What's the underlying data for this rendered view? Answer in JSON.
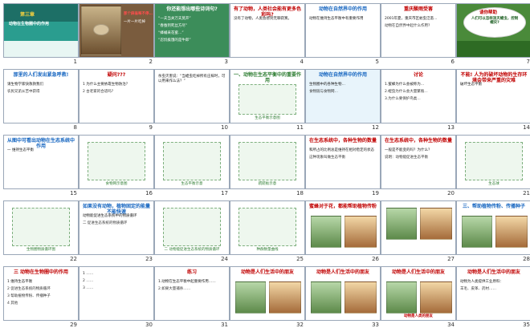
{
  "colors": {
    "frame": "#9aa7b8",
    "title_red": "#c00000",
    "teal": "#2f8f8a",
    "green": "#2e7d32",
    "sky": "#bfe3f5",
    "forest": "#3b6b2e"
  },
  "slides": [
    {
      "n": "1",
      "bg": "#2a9d8f",
      "title": "第三章",
      "body": [
        "动物在生物圈中的作用"
      ],
      "accent": "#f4d03f",
      "kind": "cover"
    },
    {
      "n": "2",
      "bg": "#7a5c3e",
      "title": "",
      "body": [
        "那个麻雀啄不停…",
        "一片一片吃掉"
      ],
      "accent": "#e74c3c",
      "kind": "photo"
    },
    {
      "n": "3",
      "bg": "#3c8d5a",
      "title": "你还能想出哪些诗词句?",
      "body": [
        "“一夫当关万夫莫开”",
        "“春蚕到死丝方尽”",
        "“蜂蛹采花蜜…”",
        "“忍饥挨饿的是牛郎”"
      ],
      "accent": "#ffffff",
      "kind": "text"
    },
    {
      "n": "4",
      "bg": "#ffffff",
      "title": "有了动物，人类社会能有更多色彩吗?",
      "body": [
        "没有了动物，人类会感到无聊寂寞。"
      ],
      "accent": "#c00000",
      "kind": "text"
    },
    {
      "n": "5",
      "bg": "#ffffff",
      "title": "动物在自然界中的作用",
      "body": [
        "动物在维持生态平衡中有重要作用"
      ],
      "accent": "#1565c0",
      "kind": "text"
    },
    {
      "n": "6",
      "bg": "#ffffff",
      "title": "重庆酸雨受害",
      "body": [
        "2001年夏，重庆市区蚊虫泛滥…",
        "动物在自然界中起什么作用?"
      ],
      "accent": "#c00000",
      "kind": "text"
    },
    {
      "n": "7",
      "bg": "#4a8a3a",
      "title": "请你帮助",
      "body": [
        "人们可以怎样消灭蝗虫，控制蝗灾?"
      ],
      "accent": "#f1c40f",
      "kind": "bubble"
    },
    {
      "n": "8",
      "bg": "#ffffff",
      "title": "那里的人们发出紧急呼救!",
      "body": [
        "请生物学家快救救我们",
        "农民兄弟从苦中获得"
      ],
      "accent": "#1565c0",
      "kind": "text"
    },
    {
      "n": "9",
      "bg": "#ffffff",
      "title": "疑问???",
      "body": [
        "1 为什么主要依靠生物防治？",
        "2 古老家的合适吗?"
      ],
      "accent": "#c00000",
      "kind": "text"
    },
    {
      "n": "10",
      "bg": "#ffffff",
      "title": "",
      "body": [
        "杀虫灭害说：“当蝗虫吃掉所有庄稼时，可以用来作么法？”"
      ],
      "accent": "#1565c0",
      "kind": "text"
    },
    {
      "n": "11",
      "bg": "#ffffff",
      "title": "一、动物在生态平衡中的重要作用",
      "body": [
        "生态平衡示意图"
      ],
      "accent": "#2e7d32",
      "kind": "diagram"
    },
    {
      "n": "12",
      "bg": "#e8f4fb",
      "title": "动物在自然界中的作用",
      "body": [
        "生物圈中的各种生物…",
        "食物链与食物网…"
      ],
      "accent": "#1565c0",
      "kind": "text"
    },
    {
      "n": "13",
      "bg": "#ffffff",
      "title": "讨论",
      "body": [
        "1.蜜蜂为什么会被称为…",
        "2.蝗虫为什么会大量繁殖…",
        "3.为什么要保护鸟类…"
      ],
      "accent": "#c00000",
      "kind": "text"
    },
    {
      "n": "14",
      "bg": "#ffffff",
      "title": "不能! 人为的破坏动物的生存环境会带来严重的灾难",
      "body": [
        "破坏生态平衡"
      ],
      "accent": "#c00000",
      "kind": "text"
    },
    {
      "n": "15",
      "bg": "#ffffff",
      "title": "从图中可看出动物在生态系统中作用",
      "body": [
        "一 维持生态平衡"
      ],
      "accent": "#1565c0",
      "kind": "text"
    },
    {
      "n": "16",
      "bg": "#ffffff",
      "title": "",
      "body": [
        "食物网示意图"
      ],
      "accent": "#2e7d32",
      "kind": "diagram"
    },
    {
      "n": "17",
      "bg": "#ffffff",
      "title": "",
      "body": [
        "生态平衡示意"
      ],
      "accent": "#2e7d32",
      "kind": "diagram"
    },
    {
      "n": "18",
      "bg": "#ffffff",
      "title": "",
      "body": [
        "跷跷板示意"
      ],
      "accent": "#2e7d32",
      "kind": "diagram"
    },
    {
      "n": "19",
      "bg": "#ffffff",
      "title": "在生态系统中，各种生物的数量",
      "body": [
        "和所占的比例总是维持在相对稳定的状态",
        "这种现象叫做生态平衡"
      ],
      "accent": "#c00000",
      "kind": "text"
    },
    {
      "n": "20",
      "bg": "#ffffff",
      "title": "在生态系统中，各种生物的数量",
      "body": [
        "一般是不能变的吗？为什么？",
        "说明：动物能促进生态平衡"
      ],
      "accent": "#c00000",
      "kind": "text"
    },
    {
      "n": "21",
      "bg": "#ffffff",
      "title": "",
      "body": [
        "生态球"
      ],
      "accent": "#2e7d32",
      "kind": "diagram"
    },
    {
      "n": "22",
      "bg": "#ffffff",
      "title": "",
      "body": [
        "生物圈物质循环图"
      ],
      "accent": "#2e7d32",
      "kind": "diagram"
    },
    {
      "n": "23",
      "bg": "#ffffff",
      "title": "如果没有动物，植物固定的能量不能快速",
      "body": [
        "动物能促进生态系统中的物质循环",
        "二 促进生态系统的物质循环"
      ],
      "accent": "#1565c0",
      "kind": "text"
    },
    {
      "n": "24",
      "bg": "#ffffff",
      "title": "",
      "body": [
        "二 动物能促进生态系统的物质循环"
      ],
      "accent": "#1565c0",
      "kind": "diagram"
    },
    {
      "n": "25",
      "bg": "#ffffff",
      "title": "",
      "body": [
        "种群数量曲线"
      ],
      "accent": "#2e7d32",
      "kind": "diagram"
    },
    {
      "n": "26",
      "bg": "#ffffff",
      "title": "蜜蜂对于花，都能帮助植物传粉",
      "body": [
        ""
      ],
      "accent": "#c00000",
      "kind": "photo"
    },
    {
      "n": "27",
      "bg": "#ffffff",
      "title": "",
      "body": [
        ""
      ],
      "accent": "#2e7d32",
      "kind": "photo"
    },
    {
      "n": "28",
      "bg": "#ffffff",
      "title": "三、帮助植物传粉、传播种子",
      "body": [
        ""
      ],
      "accent": "#1565c0",
      "kind": "photo"
    },
    {
      "n": "29",
      "bg": "#ffffff",
      "title": "三 动物在生物圈中的作用",
      "body": [
        "1 维持生态平衡",
        "2 促进生态系统的物质循环",
        "3 帮助植物传粉、传播种子",
        "4 其他"
      ],
      "accent": "#c00000",
      "kind": "text"
    },
    {
      "n": "30",
      "bg": "#ffffff",
      "title": "",
      ":": "",
      "body": [
        "1 ……",
        "2 ……",
        "3 ……"
      ],
      "accent": "#1565c0",
      "kind": "text"
    },
    {
      "n": "31",
      "bg": "#ffffff",
      "title": "练习",
      "body": [
        "1.动物在生态平衡中起重要作用……",
        "2.如果大量捕杀……"
      ],
      "accent": "#c00000",
      "kind": "text"
    },
    {
      "n": "32",
      "bg": "#ffffff",
      "title": "动物是人们生活中的朋友",
      "body": [
        ""
      ],
      "accent": "#c00000",
      "kind": "photo"
    },
    {
      "n": "33",
      "bg": "#ffffff",
      "title": "动物是人们生活中的朋友",
      "body": [
        ""
      ],
      "accent": "#c00000",
      "kind": "photo"
    },
    {
      "n": "34",
      "bg": "#ffffff",
      "title": "动物是人们生活中的朋友",
      "body": [
        "动物是人类的朋友"
      ],
      "accent": "#c00000",
      "kind": "photo"
    },
    {
      "n": "35",
      "bg": "#ffffff",
      "title": "动物是人们生活中的朋友",
      "body": [
        "动物为人类提供工业原料：",
        "羊毛、皮革、药材……"
      ],
      "accent": "#c00000",
      "kind": "text"
    }
  ]
}
